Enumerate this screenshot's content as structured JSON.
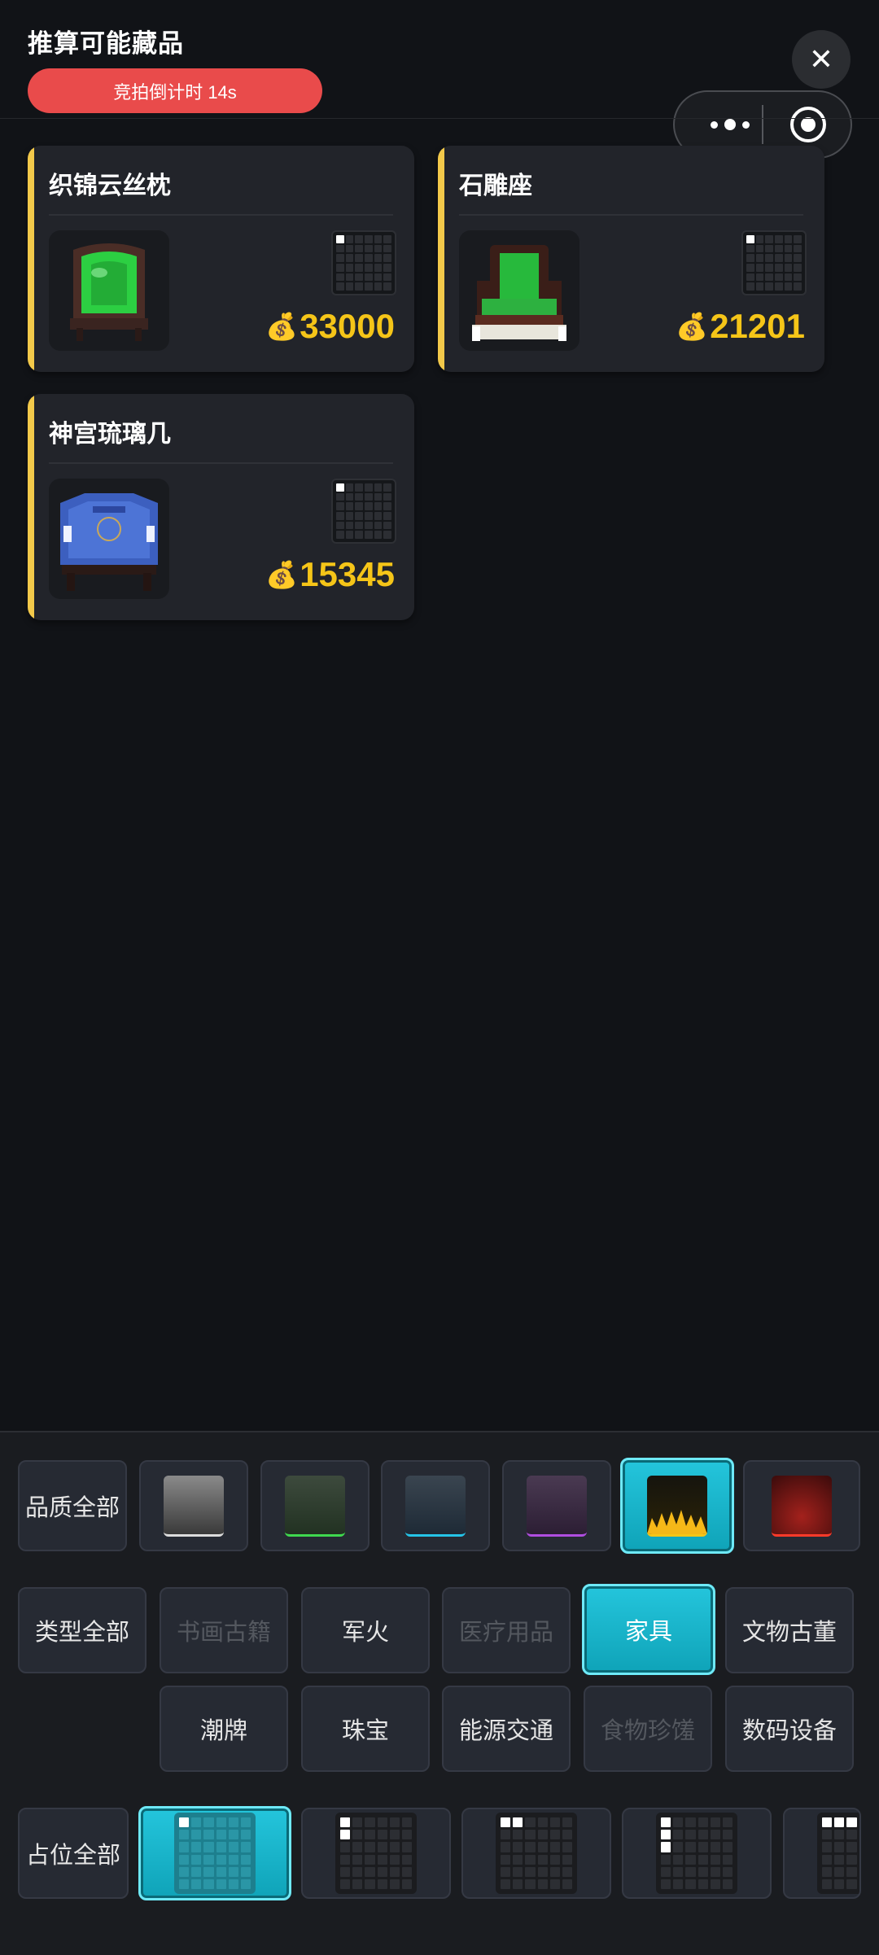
{
  "header": {
    "title": "推算可能藏品",
    "countdown": "竞拍倒计时 14s",
    "close_icon": "✕"
  },
  "items": [
    {
      "name": "织锦云丝枕",
      "price": "33000",
      "money_icon": "💰",
      "image": "green-jade-screen",
      "grid_shape": "1x1"
    },
    {
      "name": "石雕座",
      "price": "21201",
      "money_icon": "💰",
      "image": "green-throne-chair",
      "grid_shape": "1x1"
    },
    {
      "name": "神宫琉璃几",
      "price": "15345",
      "money_icon": "💰",
      "image": "blue-glazed-screen",
      "grid_shape": "1x1"
    }
  ],
  "filters": {
    "quality": {
      "all_label": "品质全部",
      "options": [
        {
          "color_name": "white",
          "accent": "#dddddd",
          "selected": false
        },
        {
          "color_name": "green",
          "accent": "#3fd94f",
          "selected": false
        },
        {
          "color_name": "blue",
          "accent": "#25c4e8",
          "selected": false
        },
        {
          "color_name": "purple",
          "accent": "#b04de0",
          "selected": false
        },
        {
          "color_name": "gold",
          "accent": "#f5c518",
          "selected": true
        },
        {
          "color_name": "red",
          "accent": "#ff3a2a",
          "selected": false
        }
      ]
    },
    "type": {
      "all_label": "类型全部",
      "options": [
        {
          "label": "书画古籍",
          "state": "disabled"
        },
        {
          "label": "军火",
          "state": "normal"
        },
        {
          "label": "医疗用品",
          "state": "disabled"
        },
        {
          "label": "家具",
          "state": "selected"
        },
        {
          "label": "文物古董",
          "state": "normal"
        },
        {
          "label": "潮牌",
          "state": "normal"
        },
        {
          "label": "珠宝",
          "state": "normal"
        },
        {
          "label": "能源交通",
          "state": "normal"
        },
        {
          "label": "食物珍馐",
          "state": "disabled"
        },
        {
          "label": "数码设备",
          "state": "normal"
        }
      ]
    },
    "size": {
      "all_label": "占位全部",
      "options": [
        {
          "shape": "1x1",
          "selected": true
        },
        {
          "shape": "1x2 vertical",
          "selected": false
        },
        {
          "shape": "2x1 horizontal",
          "selected": false
        },
        {
          "shape": "1x3 vertical",
          "selected": false
        },
        {
          "shape": "3x1 horizontal",
          "selected": false
        }
      ]
    }
  },
  "colors": {
    "background": "#111317",
    "card": "#22242a",
    "accent_yellow": "#f3c94a",
    "price": "#f5c518",
    "countdown_bg": "#e94b4b",
    "active_cyan": "#14b6cc"
  }
}
